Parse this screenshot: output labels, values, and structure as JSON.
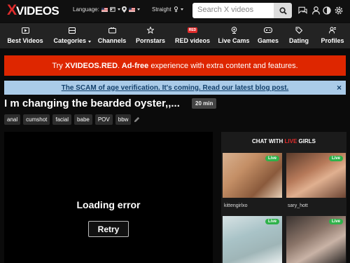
{
  "header": {
    "logo_x": "X",
    "logo_word": "VIDEOS",
    "language_label": "Language:",
    "orientation_label": "Straight",
    "search_placeholder": "Search X videos"
  },
  "nav": [
    {
      "label": "Best Videos",
      "icon": "play-box-icon"
    },
    {
      "label": "Categories",
      "icon": "grid-icon",
      "dropdown": true
    },
    {
      "label": "Channels",
      "icon": "tv-icon"
    },
    {
      "label": "Pornstars",
      "icon": "star-icon"
    },
    {
      "label": "RED videos",
      "icon": "red-badge-icon",
      "badge": "RED"
    },
    {
      "label": "Live Cams",
      "icon": "webcam-icon"
    },
    {
      "label": "Games",
      "icon": "gamepad-icon"
    },
    {
      "label": "Dating",
      "icon": "tag-icon"
    },
    {
      "label": "Profiles",
      "icon": "profile-icon"
    }
  ],
  "promo_banner": {
    "pre": "Try ",
    "link": "XVIDEOS.RED",
    "dot": ".",
    "bold": " Ad-free",
    "post": " experience with extra content and features."
  },
  "notice_banner": {
    "text": "The SCAM of age verification. It's coming. Read our latest blog post.",
    "close": "×"
  },
  "video": {
    "title": "I m changing the bearded oyster,,...",
    "duration": "20 min",
    "tags": [
      "anal",
      "cumshot",
      "facial",
      "babe",
      "POV",
      "bbw"
    ],
    "error_text": "Loading error",
    "retry_label": "Retry"
  },
  "chat": {
    "title_pre": "CHAT WITH ",
    "title_live": "LIVE",
    "title_post": " GIRLS",
    "live_badge": "Live",
    "cams": [
      {
        "name": "kittengirlxo"
      },
      {
        "name": "sary_hott"
      },
      {
        "name": ""
      },
      {
        "name": ""
      }
    ]
  },
  "colors": {
    "brand_red": "#e02c2c",
    "promo_red": "#de2600",
    "notice_blue": "#aacbe8",
    "live_green": "#2fb24a"
  }
}
